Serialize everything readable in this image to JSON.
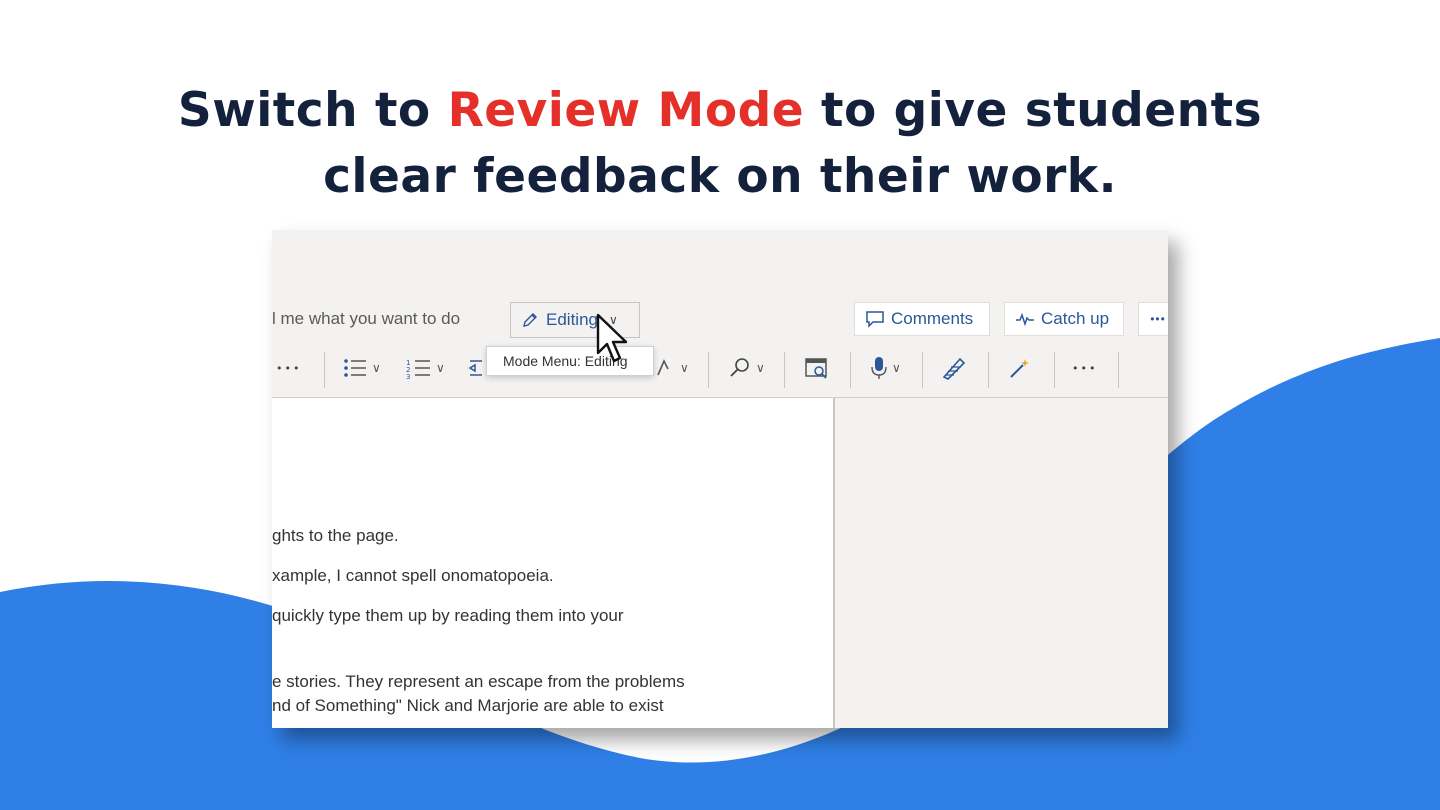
{
  "headline": {
    "line1_before": "Switch to ",
    "line1_accent": "Review Mode",
    "line1_after": " to give students",
    "line2": "clear feedback on their work."
  },
  "colors": {
    "headline": "#13213c",
    "accent": "#e5302a",
    "wave": "#2f7fe6",
    "word_blue": "#2b579a"
  },
  "toolbar": {
    "tell_me": "l me what you want to do",
    "mode_button": "Editing",
    "comments": "Comments",
    "catch_up": "Catch up",
    "more": "•••"
  },
  "tooltip": {
    "text": "Mode Menu: Editing"
  },
  "ribbon": {
    "more1": "•••",
    "more2": "•••",
    "icons": [
      "bullets-icon",
      "numbering-icon",
      "indent-icon",
      "styles-icon",
      "find-icon",
      "reuse-files-icon",
      "dictate-icon",
      "editor-icon",
      "designer-icon"
    ]
  },
  "document": {
    "lines": [
      "ghts to the page.",
      "xample, I cannot spell onomatopoeia.",
      "quickly type them up by reading them into your",
      "e stories. They represent an escape from the problems",
      "nd of Something\" Nick and Marjorie are able to exist"
    ]
  }
}
